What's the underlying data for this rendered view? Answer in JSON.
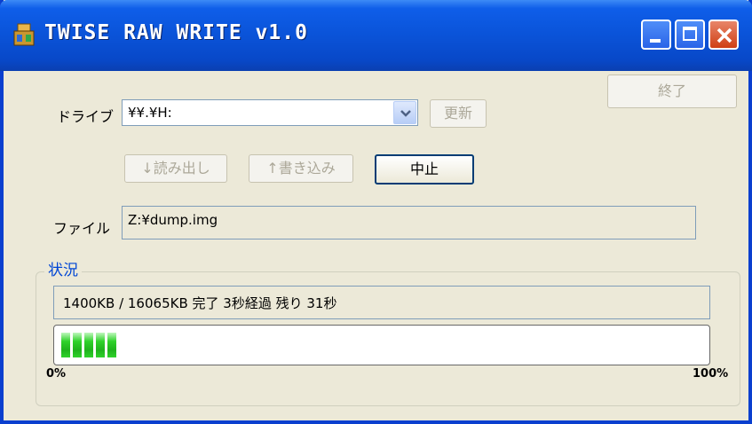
{
  "window": {
    "title": "TWISE RAW WRITE v1.0"
  },
  "drive": {
    "label": "ドライブ",
    "selected": "¥¥.¥H:",
    "refresh_label": "更新"
  },
  "actions": {
    "read_label": "↓読み出し",
    "write_label": "↑書き込み",
    "abort_label": "中止",
    "exit_label": "終了"
  },
  "file": {
    "label": "ファイル",
    "path": "Z:¥dump.img"
  },
  "status": {
    "group_label": "状況",
    "message": "1400KB / 16065KB 完了 3秒経過  残り 31秒",
    "progress_fraction": 0.087,
    "min_label": "0%",
    "max_label": "100%"
  },
  "colors": {
    "title_bar": "#0a53d8",
    "progress_fill": "#2fd22b",
    "group_title": "#0046d5"
  }
}
